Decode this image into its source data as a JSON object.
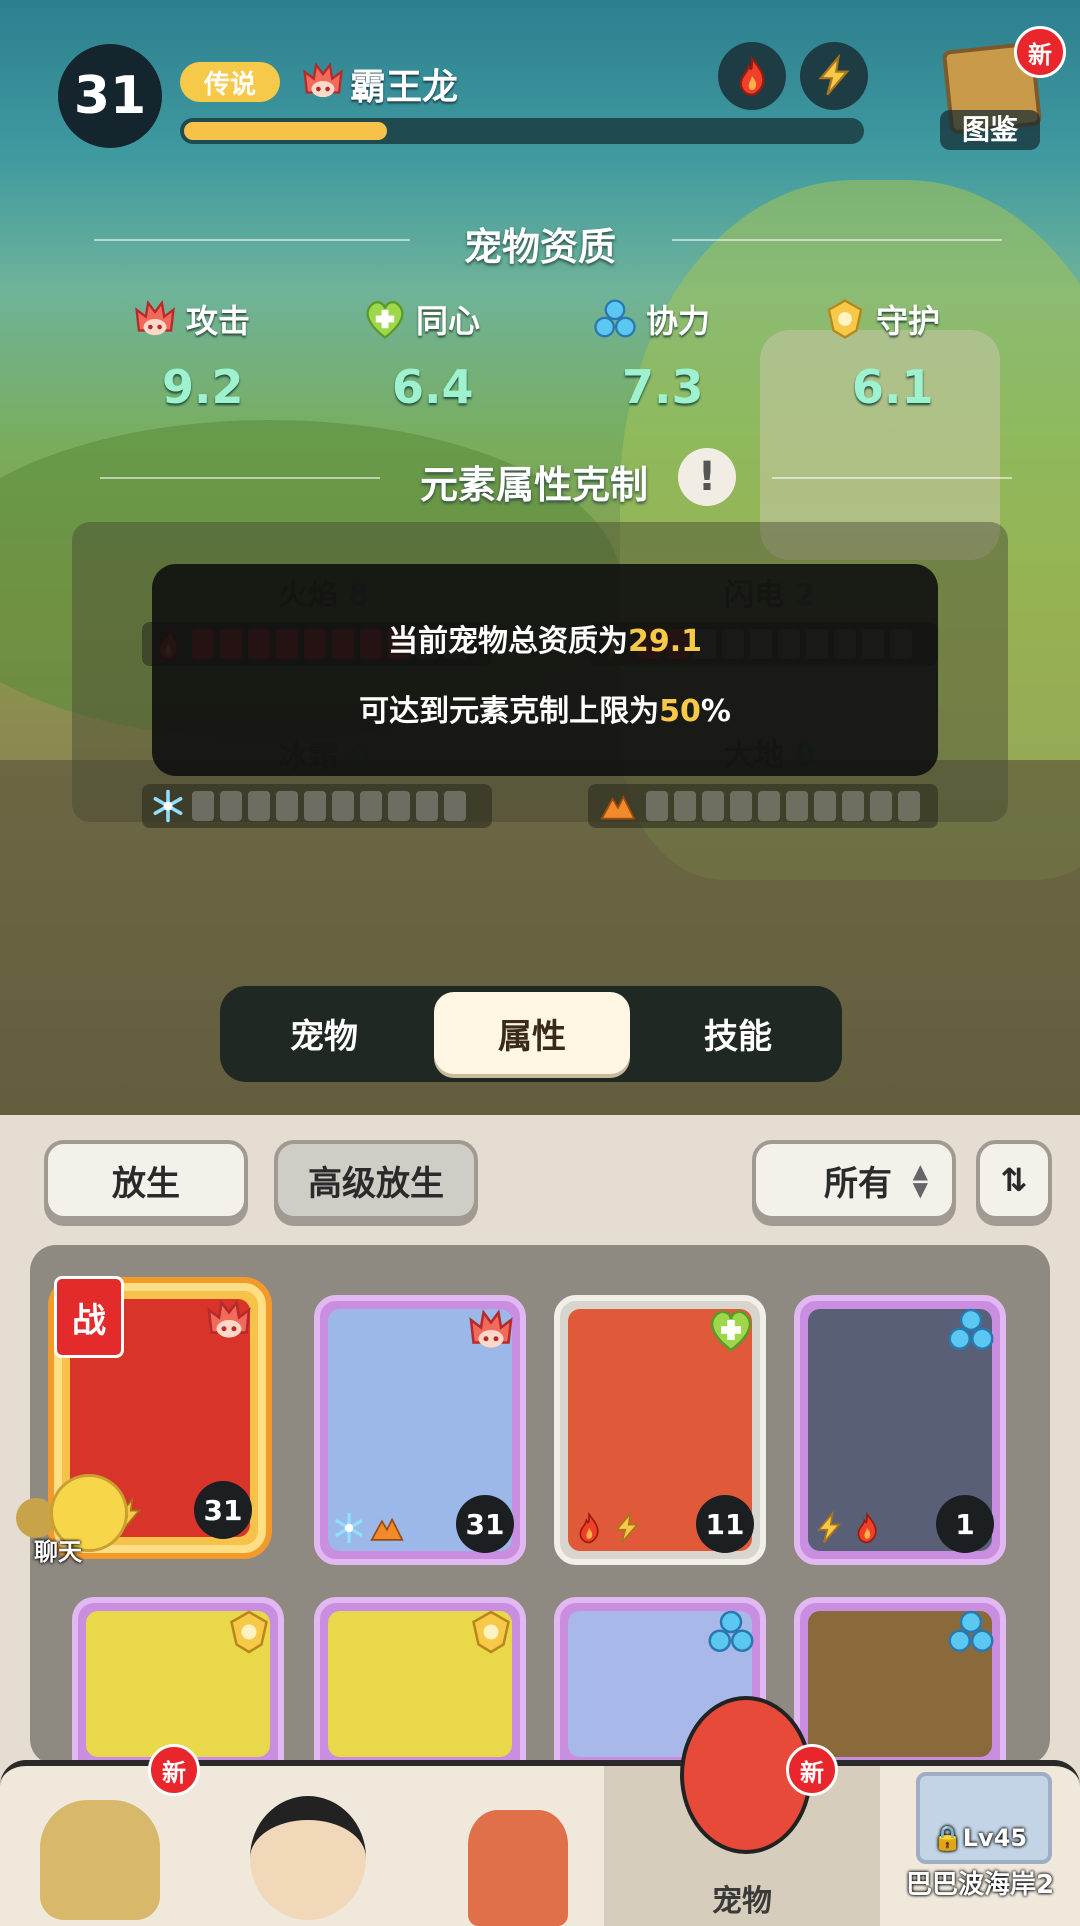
{
  "header": {
    "level": "31",
    "rarity": "传说",
    "pet_name": "霸王龙",
    "exp_fraction": 0.3,
    "elements": [
      "fire-icon",
      "lightning-icon"
    ],
    "codex": {
      "label": "图鉴",
      "badge": "新"
    }
  },
  "aptitude": {
    "title": "宠物资质",
    "stats": [
      {
        "label": "攻击",
        "value": "9.2",
        "icon": "attack-icon"
      },
      {
        "label": "同心",
        "value": "6.4",
        "icon": "heart-icon"
      },
      {
        "label": "协力",
        "value": "7.3",
        "icon": "cooperation-icon"
      },
      {
        "label": "守护",
        "value": "6.1",
        "icon": "guard-icon"
      }
    ]
  },
  "element_restraint": {
    "title": "元素属性克制",
    "elements": [
      {
        "name": "火焰",
        "value": "8",
        "filled": 8,
        "total": 10
      },
      {
        "name": "闪电",
        "value": "2",
        "filled": 2,
        "total": 10
      },
      {
        "name": "冰霜",
        "value": "0",
        "filled": 0,
        "total": 10
      },
      {
        "name": "大地",
        "value": "0",
        "filled": 0,
        "total": 10
      }
    ],
    "tooltip": {
      "line1_prefix": "当前宠物总资质为",
      "line1_value": "29.1",
      "line2_prefix": "可达到元素克制上限为",
      "line2_value": "50",
      "line2_suffix": "%"
    }
  },
  "tabs": [
    {
      "label": "宠物",
      "active": false
    },
    {
      "label": "属性",
      "active": true
    },
    {
      "label": "技能",
      "active": false
    }
  ],
  "actions": {
    "release": "放生",
    "advanced_release": "高级放生",
    "filter": "所有"
  },
  "pets": [
    {
      "level": "31",
      "frame": "gold",
      "class": "attack-icon",
      "elements": [
        "fire-icon",
        "lightning-icon"
      ],
      "in_battle": true
    },
    {
      "level": "31",
      "frame": "purple",
      "class": "attack-icon",
      "elements": [
        "ice-icon",
        "earth-icon"
      ]
    },
    {
      "level": "11",
      "frame": "gray",
      "class": "heart-icon",
      "elements": [
        "fire-icon",
        "lightning-icon"
      ]
    },
    {
      "level": "1",
      "frame": "purple",
      "class": "cooperation-icon",
      "elements": [
        "lightning-icon",
        "fire-icon"
      ]
    },
    {
      "frame": "purple",
      "class": "guard-icon"
    },
    {
      "frame": "purple",
      "class": "guard-icon"
    },
    {
      "frame": "purple",
      "class": "cooperation-icon"
    },
    {
      "frame": "purple",
      "class": "cooperation-icon"
    }
  ],
  "battle_tag": "战",
  "chat": {
    "label": "聊天"
  },
  "nav": {
    "items": [
      {
        "badge": "新"
      },
      {},
      {},
      {
        "label": "宠物",
        "badge": "新",
        "active": true
      }
    ],
    "map": {
      "level": "Lv45",
      "name": "巴巴波海岸2"
    }
  },
  "colors": {
    "gold": "#f6c24a",
    "purple_frame": "#c98ee0",
    "stat_value": "#9ff2d0",
    "badge_red": "#e8262b"
  }
}
